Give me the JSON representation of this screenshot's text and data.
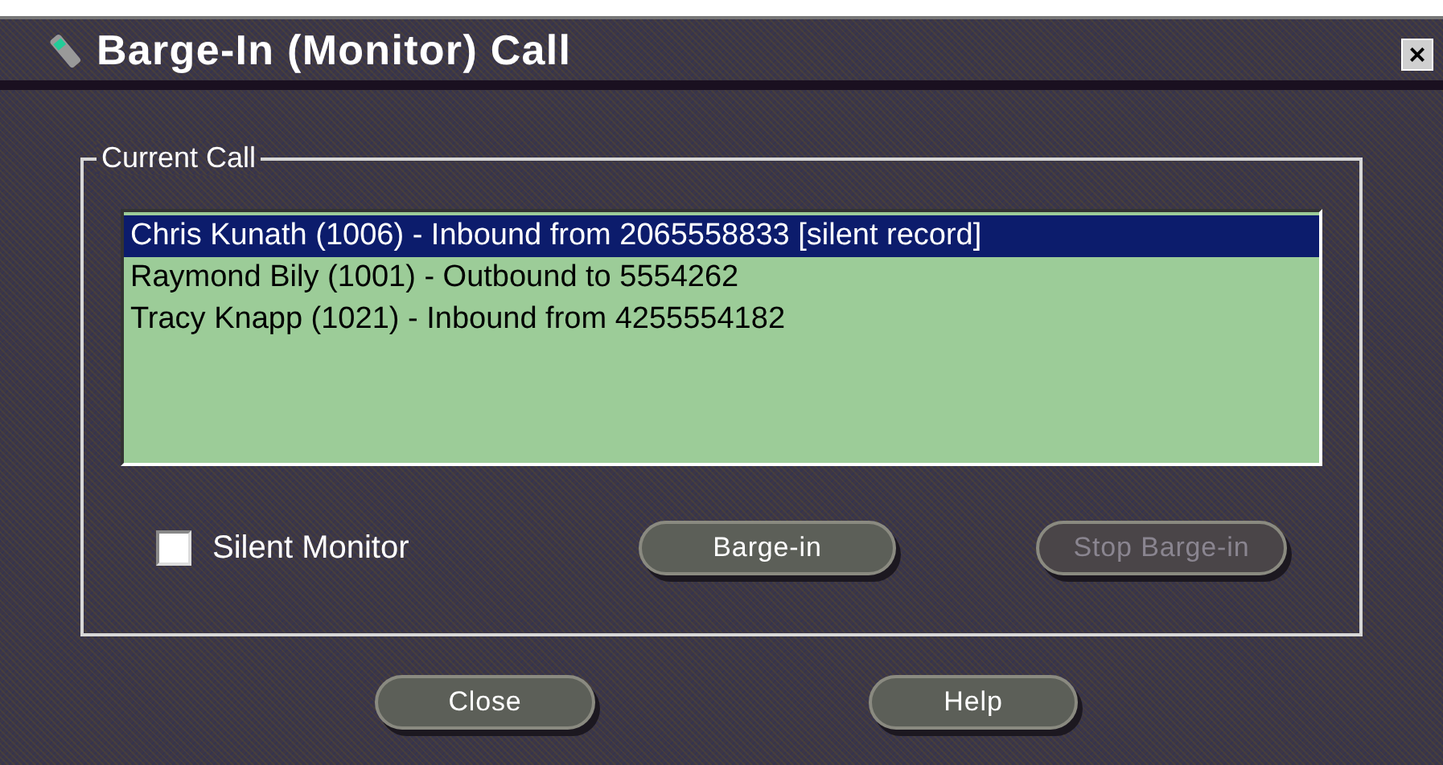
{
  "window": {
    "title": "Barge-In (Monitor) Call",
    "close_label": "×"
  },
  "group": {
    "title": "Current Call"
  },
  "calls": [
    {
      "text": "Chris Kunath (1006) - Inbound from 2065558833 [silent record]",
      "selected": true
    },
    {
      "text": "Raymond Bily (1001) - Outbound to 5554262",
      "selected": false
    },
    {
      "text": "Tracy Knapp (1021) - Inbound from 4255554182",
      "selected": false
    }
  ],
  "silent_monitor": {
    "label": "Silent Monitor",
    "checked": false
  },
  "actions": [
    {
      "label": "Barge-in",
      "disabled": false
    },
    {
      "label": "Stop Barge-in",
      "disabled": true
    }
  ],
  "footer_buttons": [
    {
      "label": "Close",
      "disabled": false
    },
    {
      "label": "Help",
      "disabled": false
    }
  ]
}
